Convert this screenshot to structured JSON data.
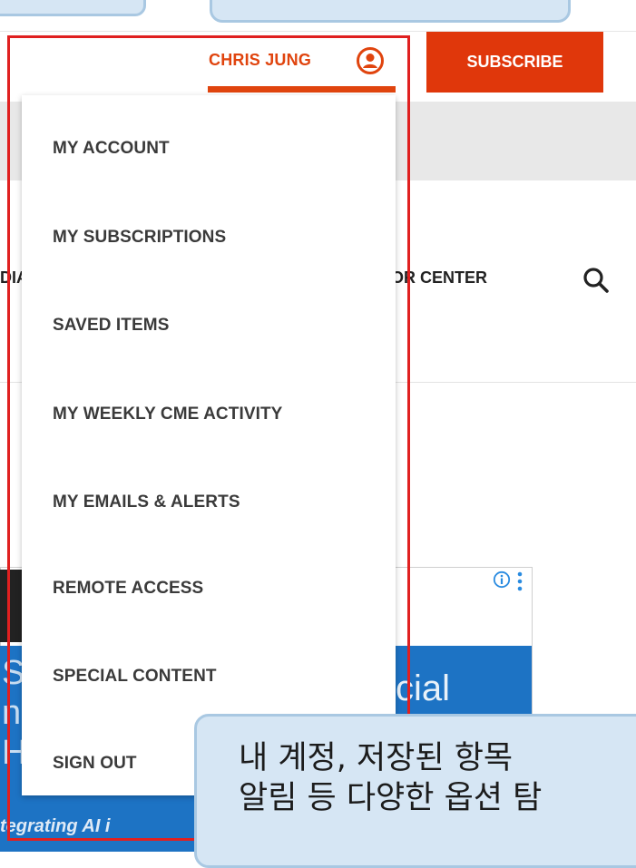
{
  "header": {
    "user_name": "CHRIS JUNG",
    "subscribe_label": "SUBSCRIBE"
  },
  "nav": {
    "fragment_left": "DIA",
    "author_center": "HOR CENTER"
  },
  "menu": {
    "items": [
      "MY ACCOUNT",
      "MY SUBSCRIPTIONS",
      "SAVED ITEMS",
      "MY WEEKLY CME ACTIVITY",
      "MY EMAILS & ALERTS",
      "REMOTE ACCESS",
      "SPECIAL CONTENT",
      "SIGN OUT"
    ]
  },
  "ad": {
    "text_right": "cial",
    "text_left": "Sy\nn\nH",
    "bottom_text": "tegrating AI i"
  },
  "caption": {
    "line1": "내 계정, 저장된 항목",
    "line2": "알림 등 다양한 옵션 탐"
  },
  "colors": {
    "accent": "#e0440e",
    "subscribe_bg": "#e0370b",
    "highlight": "#e02020",
    "callout_bg": "#d6e6f4",
    "ad_blue": "#1d73c4"
  }
}
